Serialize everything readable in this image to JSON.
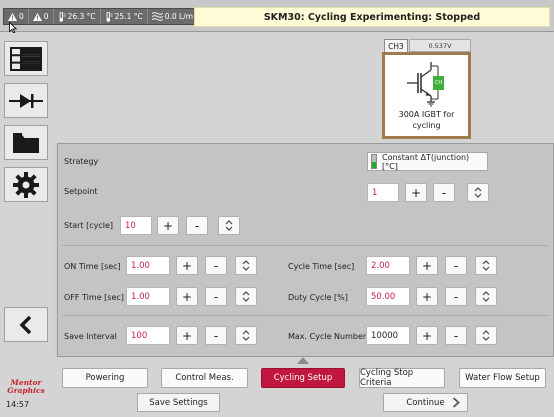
{
  "status": {
    "alarm_count_1": "0",
    "alarm_count_2": "0",
    "temperature_1": "26.3 °C",
    "temperature_2": "25.1 °C",
    "flow": "0.0 L/m"
  },
  "window_title": "SKM30: Cycling Experimenting: Stopped",
  "sidebar": {
    "icons": [
      "grid-icon",
      "diode-icon",
      "folder-icon",
      "gear-icon",
      "back-chevron-icon"
    ],
    "logo_line_1": "Mentor",
    "logo_line_2": "Graphics",
    "clock": "14:57"
  },
  "channel": {
    "tab": "CH3",
    "voltage": "0.537V",
    "device_label": "300A IGBT for cycling",
    "badge": "CH"
  },
  "settings": {
    "strategy_label": "Strategy",
    "strategy_value": "Constant ΔT(junction) [°C]",
    "setpoint_label": "Setpoint",
    "setpoint_value": "1",
    "start_label": "Start [cycle]",
    "start_value": "10",
    "on_time_label": "ON Time [sec]",
    "on_time_value": "1.00",
    "off_time_label": "OFF Time [sec]",
    "off_time_value": "1.00",
    "save_interval_label": "Save Interval",
    "save_interval_value": "100",
    "cycle_time_label": "Cycle Time [sec]",
    "cycle_time_value": "2.00",
    "duty_cycle_label": "Duty Cycle [%]",
    "duty_cycle_value": "50.00",
    "max_cycle_label": "Max. Cycle Number",
    "max_cycle_value": "10000",
    "plus": "+",
    "minus": "-"
  },
  "tabs": [
    "Powering",
    "Control Meas.",
    "Cycling Setup",
    "Cycling Stop Criteria",
    "Water Flow Setup"
  ],
  "active_tab": "Cycling Setup",
  "actions": {
    "save": "Save Settings",
    "continue": "Continue"
  },
  "colors": {
    "accent": "#c0163f",
    "value_text": "#c4204a",
    "title_bg": "#fffbd6",
    "card_border": "#a07a4a"
  }
}
